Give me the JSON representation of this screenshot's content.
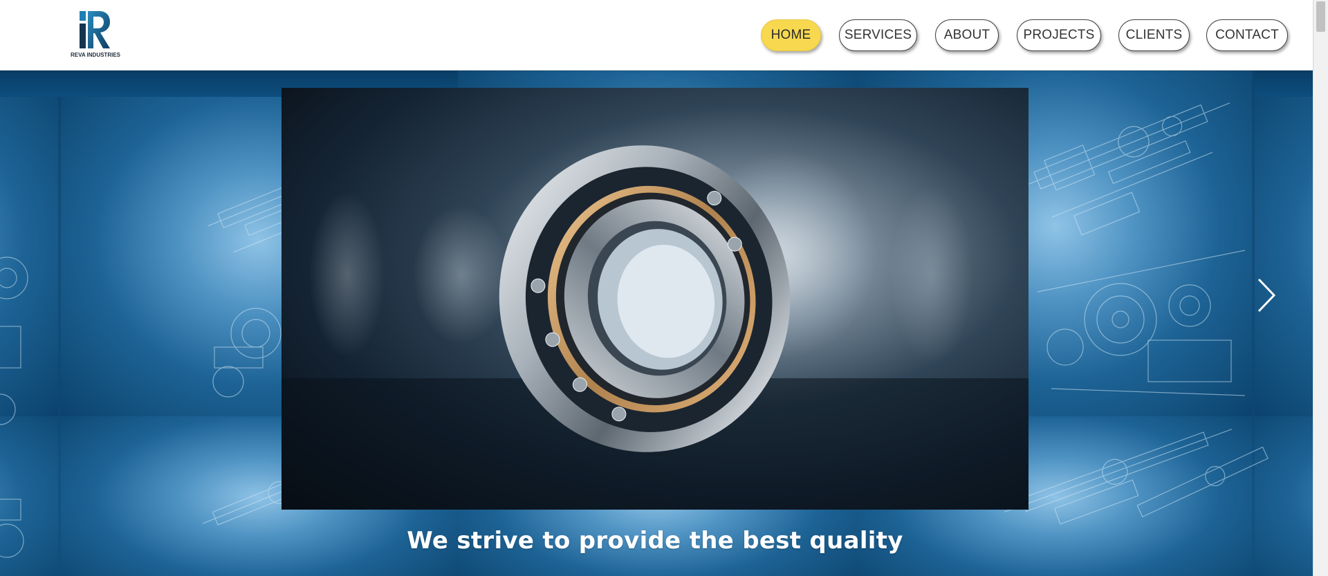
{
  "header": {
    "logo_text": "REVA INDUSTRIES",
    "nav": [
      {
        "label": "HOME",
        "active": true
      },
      {
        "label": "SERVICES",
        "active": false
      },
      {
        "label": "ABOUT",
        "active": false
      },
      {
        "label": "PROJECTS",
        "active": false
      },
      {
        "label": "CLIENTS",
        "active": false
      },
      {
        "label": "CONTACT",
        "active": false
      }
    ]
  },
  "hero": {
    "tagline": "We strive to provide the best quality",
    "next_icon": "chevron-right-icon",
    "media": "ball-bearing-video"
  },
  "colors": {
    "active_nav": "#f7d84f",
    "hero_blue": "#1d6395",
    "logo_blue": "#1b6a98"
  }
}
